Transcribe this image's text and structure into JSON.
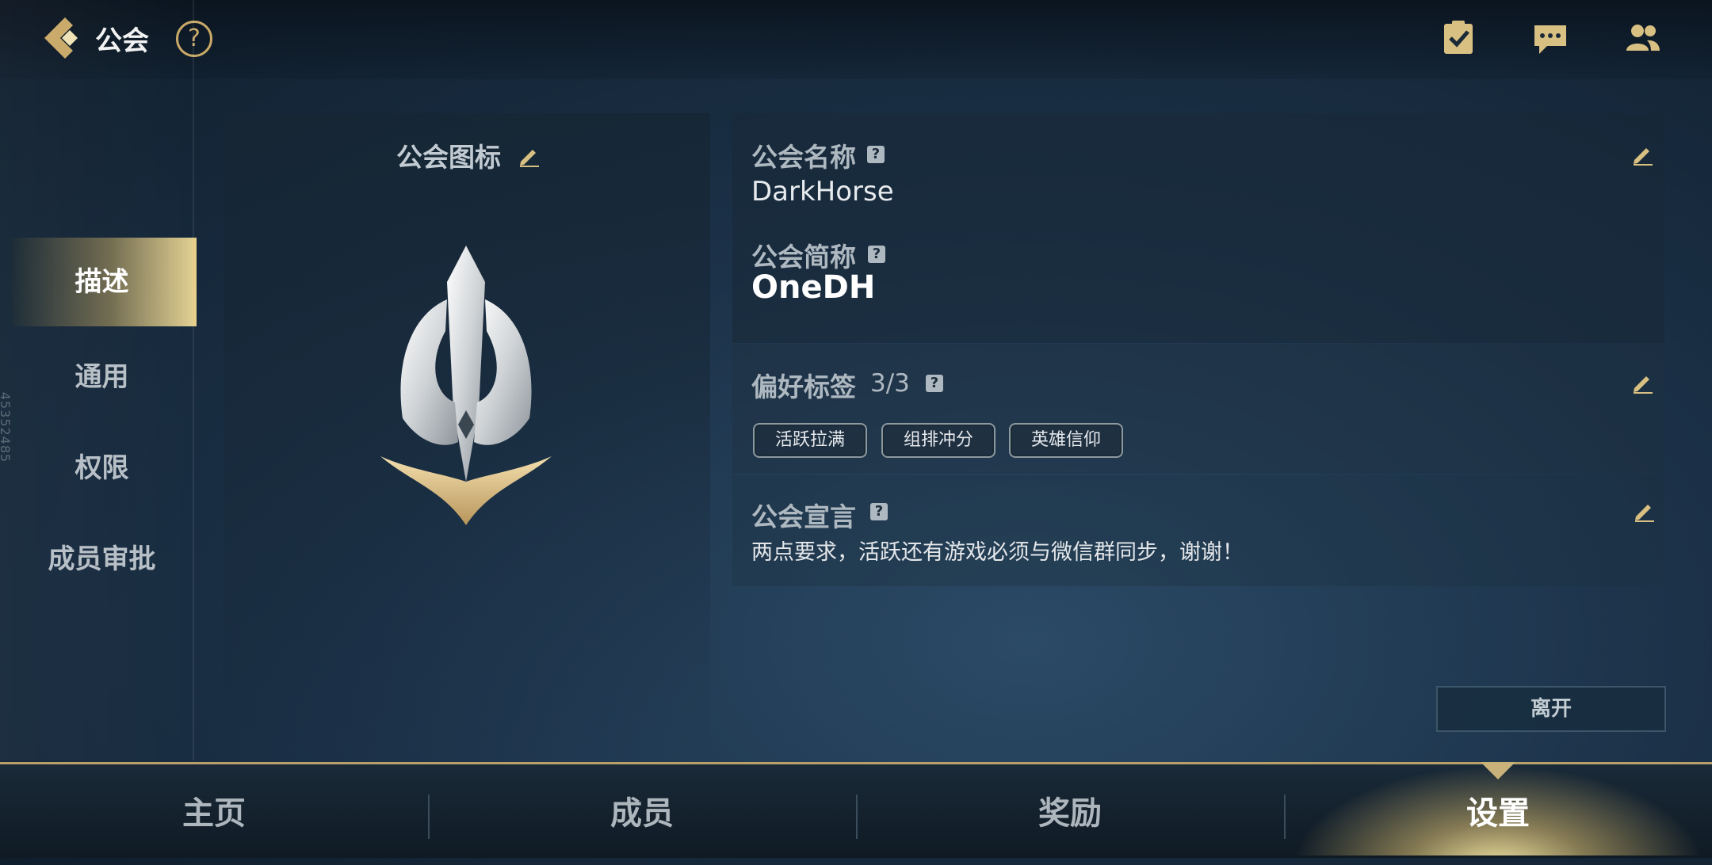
{
  "header": {
    "title": "公会",
    "help_symbol": "?"
  },
  "sidebar": {
    "items": [
      {
        "label": "描述",
        "active": true
      },
      {
        "label": "通用",
        "active": false
      },
      {
        "label": "权限",
        "active": false
      },
      {
        "label": "成员审批",
        "active": false
      }
    ],
    "watermark_id": "45352485"
  },
  "emblem": {
    "title": "公会图标"
  },
  "info": {
    "name_label": "公会名称",
    "name_value": "DarkHorse",
    "short_label": "公会简称",
    "short_value": "OneDH",
    "pref_label": "偏好标签",
    "pref_count": "3/3",
    "tags": [
      "活跃拉满",
      "组排冲分",
      "英雄信仰"
    ],
    "declaration_label": "公会宣言",
    "declaration_text": "两点要求，活跃还有游戏必须与微信群同步，谢谢！",
    "help_symbol": "?"
  },
  "actions": {
    "leave_label": "离开"
  },
  "bottom_nav": {
    "tabs": [
      {
        "label": "主页",
        "active": false
      },
      {
        "label": "成员",
        "active": false
      },
      {
        "label": "奖励",
        "active": false
      },
      {
        "label": "设置",
        "active": true
      }
    ]
  },
  "colors": {
    "accent_gold": "#c9a968",
    "background": "#1c3249"
  },
  "icons": [
    "back-arrow-icon",
    "help-icon",
    "task-checklist-icon",
    "chat-icon",
    "friends-icon",
    "edit-pencil-icon",
    "guild-emblem"
  ]
}
